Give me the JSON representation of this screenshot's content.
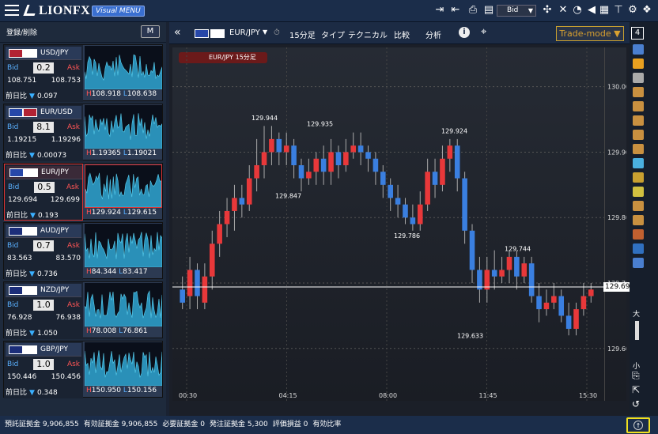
{
  "app": {
    "logo": "LIONFX",
    "menu_badge": "Visual MENU"
  },
  "topbar": {
    "price_type": "Bid"
  },
  "left_panel": {
    "register_label": "登録/削除",
    "mode_button": "M",
    "pairs": [
      {
        "symbol": "USD/JPY",
        "spread": "0.2",
        "bid": "108.751",
        "ask": "108.753",
        "prev_label": "前日比",
        "change": "0.097",
        "direction": "down",
        "high": "108.918",
        "low": "108.638",
        "selected": false
      },
      {
        "symbol": "EUR/USD",
        "spread": "8.1",
        "bid": "1.19215",
        "ask": "1.19296",
        "prev_label": "前日比",
        "change": "0.00073",
        "direction": "down",
        "high": "1.19365",
        "low": "1.19021",
        "selected": false
      },
      {
        "symbol": "EUR/JPY",
        "spread": "0.5",
        "bid": "129.694",
        "ask": "129.699",
        "prev_label": "前日比",
        "change": "0.193",
        "direction": "down",
        "high": "129.924",
        "low": "129.615",
        "selected": true
      },
      {
        "symbol": "AUD/JPY",
        "spread": "0.7",
        "bid": "83.563",
        "ask": "83.570",
        "prev_label": "前日比",
        "change": "0.736",
        "direction": "down",
        "high": "84.344",
        "low": "83.417",
        "selected": false
      },
      {
        "symbol": "NZD/JPY",
        "spread": "1.0",
        "bid": "76.928",
        "ask": "76.938",
        "prev_label": "前日比",
        "change": "1.050",
        "direction": "down",
        "high": "78.008",
        "low": "76.861",
        "selected": false
      },
      {
        "symbol": "GBP/JPY",
        "spread": "1.0",
        "bid": "150.446",
        "ask": "150.456",
        "prev_label": "前日比",
        "change": "0.348",
        "direction": "down",
        "high": "150.950",
        "low": "150.156",
        "selected": false
      }
    ],
    "bid_label": "Bid",
    "ask_label": "Ask",
    "high_prefix": "H",
    "low_prefix": "L"
  },
  "chart_toolbar": {
    "symbol": "EUR/JPY",
    "timeframe": "15分足",
    "type_label": "タイプ",
    "technical_label": "テクニカル",
    "compare_label": "比較",
    "analysis_label": "分析",
    "trade_mode": "Trade-mode ▼",
    "window_count": "4"
  },
  "chart_data": {
    "type": "candlestick",
    "title": "EUR/JPY 15分足",
    "ylim": [
      129.52,
      130.06
    ],
    "yticks": [
      "130.000",
      "129.900",
      "129.800",
      "129.700",
      "129.600"
    ],
    "xticks": [
      "00:30",
      "04:15",
      "08:00",
      "11:45",
      "15:30"
    ],
    "current_price": "129.694",
    "annotations": [
      "129.944",
      "129.935",
      "129.924",
      "129.847",
      "129.786",
      "129.744",
      "129.633"
    ],
    "candles": [
      [
        129.69,
        129.67,
        129.71,
        129.66
      ],
      [
        129.68,
        129.72,
        129.74,
        129.66
      ],
      [
        129.72,
        129.68,
        129.73,
        129.66
      ],
      [
        129.67,
        129.71,
        129.73,
        129.66
      ],
      [
        129.71,
        129.76,
        129.78,
        129.69
      ],
      [
        129.76,
        129.79,
        129.81,
        129.74
      ],
      [
        129.79,
        129.81,
        129.83,
        129.77
      ],
      [
        129.81,
        129.83,
        129.85,
        129.78
      ],
      [
        129.83,
        129.82,
        129.85,
        129.8
      ],
      [
        129.82,
        129.86,
        129.88,
        129.81
      ],
      [
        129.86,
        129.88,
        129.92,
        129.84
      ],
      [
        129.88,
        129.9,
        129.94,
        129.86
      ],
      [
        129.9,
        129.92,
        129.94,
        129.88
      ],
      [
        129.92,
        129.9,
        129.93,
        129.88
      ],
      [
        129.9,
        129.91,
        129.93,
        129.88
      ],
      [
        129.91,
        129.88,
        129.92,
        129.86
      ],
      [
        129.88,
        129.86,
        129.89,
        129.84
      ],
      [
        129.86,
        129.87,
        129.89,
        129.85
      ],
      [
        129.87,
        129.89,
        129.9,
        129.85
      ],
      [
        129.89,
        129.87,
        129.91,
        129.85
      ],
      [
        129.87,
        129.9,
        129.92,
        129.85
      ],
      [
        129.9,
        129.88,
        129.91,
        129.86
      ],
      [
        129.88,
        129.9,
        129.92,
        129.87
      ],
      [
        129.9,
        129.91,
        129.93,
        129.89
      ],
      [
        129.91,
        129.9,
        129.93,
        129.88
      ],
      [
        129.9,
        129.89,
        129.91,
        129.87
      ],
      [
        129.89,
        129.87,
        129.9,
        129.85
      ],
      [
        129.87,
        129.85,
        129.88,
        129.83
      ],
      [
        129.85,
        129.83,
        129.86,
        129.81
      ],
      [
        129.83,
        129.82,
        129.85,
        129.8
      ],
      [
        129.82,
        129.8,
        129.83,
        129.79
      ],
      [
        129.8,
        129.79,
        129.82,
        129.78
      ],
      [
        129.79,
        129.82,
        129.84,
        129.78
      ],
      [
        129.82,
        129.87,
        129.89,
        129.81
      ],
      [
        129.87,
        129.85,
        129.89,
        129.83
      ],
      [
        129.85,
        129.89,
        129.91,
        129.84
      ],
      [
        129.89,
        129.91,
        129.92,
        129.87
      ],
      [
        129.91,
        129.86,
        129.92,
        129.84
      ],
      [
        129.86,
        129.78,
        129.87,
        129.76
      ],
      [
        129.78,
        129.72,
        129.79,
        129.7
      ],
      [
        129.72,
        129.69,
        129.74,
        129.67
      ],
      [
        129.69,
        129.72,
        129.74,
        129.67
      ],
      [
        129.72,
        129.71,
        129.75,
        129.69
      ],
      [
        129.71,
        129.72,
        129.74,
        129.7
      ],
      [
        129.72,
        129.74,
        129.75,
        129.7
      ],
      [
        129.74,
        129.71,
        129.75,
        129.69
      ],
      [
        129.71,
        129.73,
        129.74,
        129.7
      ],
      [
        129.73,
        129.68,
        129.74,
        129.67
      ],
      [
        129.68,
        129.66,
        129.7,
        129.64
      ],
      [
        129.66,
        129.67,
        129.69,
        129.65
      ],
      [
        129.67,
        129.68,
        129.7,
        129.66
      ],
      [
        129.68,
        129.65,
        129.69,
        129.64
      ],
      [
        129.65,
        129.63,
        129.67,
        129.62
      ],
      [
        129.63,
        129.66,
        129.67,
        129.62
      ],
      [
        129.66,
        129.68,
        129.7,
        129.65
      ],
      [
        129.68,
        129.69,
        129.7,
        129.67
      ]
    ]
  },
  "status_bar": {
    "items": [
      {
        "label": "預託証拠金",
        "value": "9,906,855"
      },
      {
        "label": "有効証拠金",
        "value": "9,906,855"
      },
      {
        "label": "必要証拠金",
        "value": "0"
      },
      {
        "label": "発注証拠金",
        "value": "5,300"
      },
      {
        "label": "評価損益",
        "value": "0"
      },
      {
        "label": "有効比率",
        "value": ""
      }
    ]
  },
  "right_toolbar": {
    "size_big": "大",
    "size_small": "小"
  },
  "colors": {
    "up": "#e8383a",
    "down": "#3a7fe0",
    "accent": "#c8a030"
  }
}
